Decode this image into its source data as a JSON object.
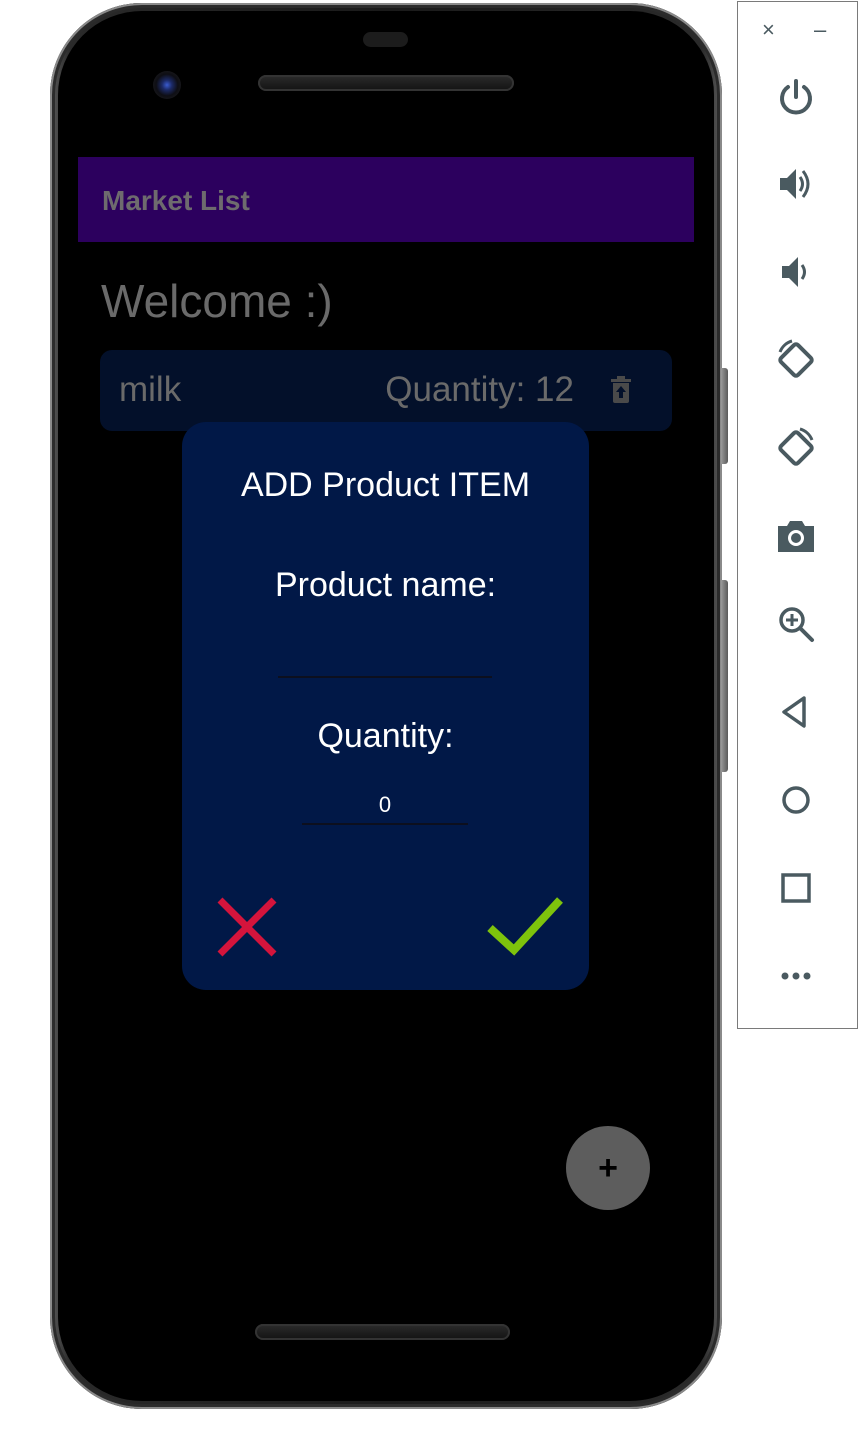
{
  "app": {
    "title": "Market List",
    "welcome": "Welcome :)",
    "colors": {
      "app_bar": "#2c005e",
      "card": "#03102a",
      "dialog": "#011847",
      "cancel": "#d4143c",
      "confirm": "#7ec30c",
      "fab": "#5d5d5d"
    }
  },
  "list": {
    "items": [
      {
        "name": "milk",
        "quantity_label": "Quantity: 12",
        "action_icon": "delete-icon"
      }
    ]
  },
  "dialog": {
    "title": "ADD Product ITEM",
    "name_label": "Product name:",
    "name_value": "",
    "quantity_label": "Quantity:",
    "quantity_value": "0",
    "cancel_icon": "close-icon",
    "confirm_icon": "check-icon"
  },
  "fab": {
    "label": "+"
  },
  "emulator_panel": {
    "window_controls": [
      "×",
      "–"
    ],
    "tools": [
      "power-icon",
      "volume-up-icon",
      "volume-down-icon",
      "rotate-left-icon",
      "rotate-right-icon",
      "camera-icon",
      "zoom-icon",
      "back-icon",
      "home-icon",
      "overview-icon",
      "more-icon"
    ]
  }
}
